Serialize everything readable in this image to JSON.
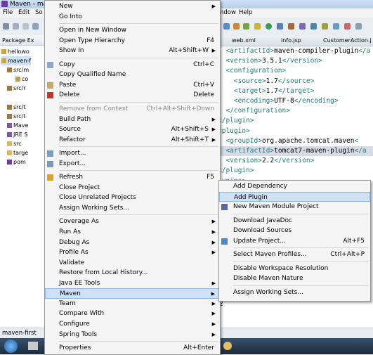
{
  "window": {
    "title": "Maven - ma"
  },
  "menubar": {
    "file": "File",
    "edit": "Edit",
    "so": "So",
    "window": "ndow",
    "help": "Help"
  },
  "explorer": {
    "tab_label": "Package Ex",
    "items": [
      "hellowo",
      "maven-f",
      "src/m",
      "co",
      "src/r",
      "src/t",
      "src/t",
      "Mave",
      "JRE S",
      "src",
      "targe",
      "pom"
    ]
  },
  "editor": {
    "tabs": [
      "web.xml",
      "info.jsp",
      "CustomerAction.j"
    ],
    "lines": [
      {
        "pre": "  ",
        "a": "<artifactId>",
        "b": "maven-compiler-plugin",
        "c": "</a"
      },
      {
        "pre": "  ",
        "a": "<version>",
        "b": "3.5.1",
        "c": "</version>"
      },
      {
        "pre": "  ",
        "a": "<configuration>",
        "b": "",
        "c": ""
      },
      {
        "pre": "    ",
        "a": "<source>",
        "b": "1.7",
        "c": "</source>"
      },
      {
        "pre": "    ",
        "a": "<target>",
        "b": "1.7",
        "c": "</target>"
      },
      {
        "pre": "    ",
        "a": "<encoding>",
        "b": "UTF-8",
        "c": "</encoding>"
      },
      {
        "pre": "  ",
        "a": "</configuration>",
        "b": "",
        "c": ""
      },
      {
        "pre": "",
        "a": "</plugin>",
        "b": "",
        "c": ""
      },
      {
        "pre": "",
        "a": "",
        "b": "",
        "c": ""
      },
      {
        "pre": "",
        "a": "<plugin>",
        "b": "",
        "c": ""
      },
      {
        "pre": "  ",
        "a": "<groupId>",
        "b": "org.apache.tomcat.maven",
        "c": "<"
      },
      {
        "pre": "  ",
        "a": "<artifactId>",
        "b": "tomcat7-maven-plugin",
        "c": "</a"
      },
      {
        "pre": "  ",
        "a": "<version>",
        "b": "2.2",
        "c": "</version>"
      },
      {
        "pre": "",
        "a": "</plugin>",
        "b": "",
        "c": ""
      },
      {
        "pre": "",
        "a": "lugins>",
        "b": "",
        "c": ""
      }
    ],
    "bottom_char": "2"
  },
  "statusbar": {
    "text": "maven-first"
  },
  "context_menu": {
    "items": [
      {
        "label": "New",
        "acc": "",
        "arrow": true
      },
      {
        "label": "Go Into",
        "acc": ""
      },
      {
        "sep": true
      },
      {
        "label": "Open in New Window",
        "acc": ""
      },
      {
        "label": "Open Type Hierarchy",
        "acc": "F4"
      },
      {
        "label": "Show In",
        "acc": "Alt+Shift+W",
        "arrow": true
      },
      {
        "sep": true
      },
      {
        "label": "Copy",
        "acc": "Ctrl+C"
      },
      {
        "label": "Copy Qualified Name",
        "acc": ""
      },
      {
        "label": "Paste",
        "acc": "Ctrl+V"
      },
      {
        "label": "Delete",
        "acc": "Delete"
      },
      {
        "sep": true
      },
      {
        "label": "Remove from Context",
        "acc": "Ctrl+Alt+Shift+Down",
        "disabled": true
      },
      {
        "label": "Build Path",
        "acc": "",
        "arrow": true
      },
      {
        "label": "Source",
        "acc": "Alt+Shift+S",
        "arrow": true
      },
      {
        "label": "Refactor",
        "acc": "Alt+Shift+T",
        "arrow": true
      },
      {
        "sep": true
      },
      {
        "label": "Import...",
        "acc": ""
      },
      {
        "label": "Export...",
        "acc": ""
      },
      {
        "sep": true
      },
      {
        "label": "Refresh",
        "acc": "F5"
      },
      {
        "label": "Close Project",
        "acc": ""
      },
      {
        "label": "Close Unrelated Projects",
        "acc": ""
      },
      {
        "label": "Assign Working Sets...",
        "acc": ""
      },
      {
        "sep": true
      },
      {
        "label": "Coverage As",
        "acc": "",
        "arrow": true
      },
      {
        "label": "Run As",
        "acc": "",
        "arrow": true
      },
      {
        "label": "Debug As",
        "acc": "",
        "arrow": true
      },
      {
        "label": "Profile As",
        "acc": "",
        "arrow": true
      },
      {
        "label": "Validate",
        "acc": ""
      },
      {
        "label": "Restore from Local History...",
        "acc": ""
      },
      {
        "label": "Java EE Tools",
        "acc": "",
        "arrow": true
      },
      {
        "label": "Maven",
        "acc": "",
        "arrow": true,
        "active": true
      },
      {
        "label": "Team",
        "acc": "",
        "arrow": true
      },
      {
        "label": "Compare With",
        "acc": "",
        "arrow": true
      },
      {
        "label": "Configure",
        "acc": "",
        "arrow": true
      },
      {
        "label": "Spring Tools",
        "acc": "",
        "arrow": true
      },
      {
        "sep": true
      },
      {
        "label": "Properties",
        "acc": "Alt+Enter"
      }
    ]
  },
  "maven_submenu": {
    "items": [
      {
        "label": "Add Dependency",
        "acc": ""
      },
      {
        "label": "Add Plugin",
        "acc": "",
        "active": true
      },
      {
        "label": "New Maven Module Project",
        "acc": ""
      },
      {
        "sep": true
      },
      {
        "label": "Download JavaDoc",
        "acc": ""
      },
      {
        "label": "Download Sources",
        "acc": ""
      },
      {
        "label": "Update Project...",
        "acc": "Alt+F5"
      },
      {
        "sep": true
      },
      {
        "label": "Select Maven Profiles...",
        "acc": "Ctrl+Alt+P"
      },
      {
        "sep": true
      },
      {
        "label": "Disable Workspace Resolution",
        "acc": ""
      },
      {
        "label": "Disable Maven Nature",
        "acc": ""
      },
      {
        "sep": true
      },
      {
        "label": "Assign Working Sets...",
        "acc": ""
      }
    ]
  }
}
